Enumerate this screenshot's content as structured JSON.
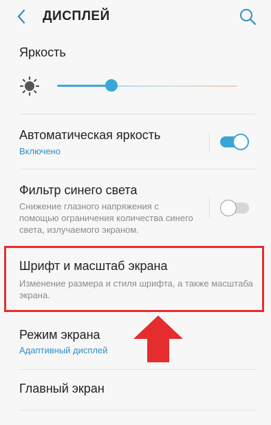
{
  "header": {
    "title": "ДИСПЛЕЙ",
    "back_icon": "chevron-left-icon",
    "search_icon": "search-icon"
  },
  "brightness": {
    "label": "Яркость",
    "icon": "sun-icon",
    "level_fraction": 0.3
  },
  "items": [
    {
      "title": "Автоматическая яркость",
      "subtitle": "Включено",
      "toggle": "on"
    },
    {
      "title": "Фильтр синего света",
      "subtitle": "Снижение глазного напряжения с помощью ограничения количества синего света, излучаемого экраном.",
      "toggle": "off"
    },
    {
      "title": "Шрифт и масштаб экрана",
      "subtitle": "Изменение размера и стиля шрифта, а также масштаба экрана."
    },
    {
      "title": "Режим экрана",
      "subtitle": "Адаптивный дисплей"
    },
    {
      "title": "Главный экран"
    }
  ],
  "colors": {
    "accent": "#3aa6d6",
    "highlight": "#e52d2d",
    "subtitle_blue": "#2d8fc4"
  },
  "annotation": {
    "highlight_target": "Шрифт и масштаб экрана",
    "arrow_icon": "arrow-up-icon"
  }
}
